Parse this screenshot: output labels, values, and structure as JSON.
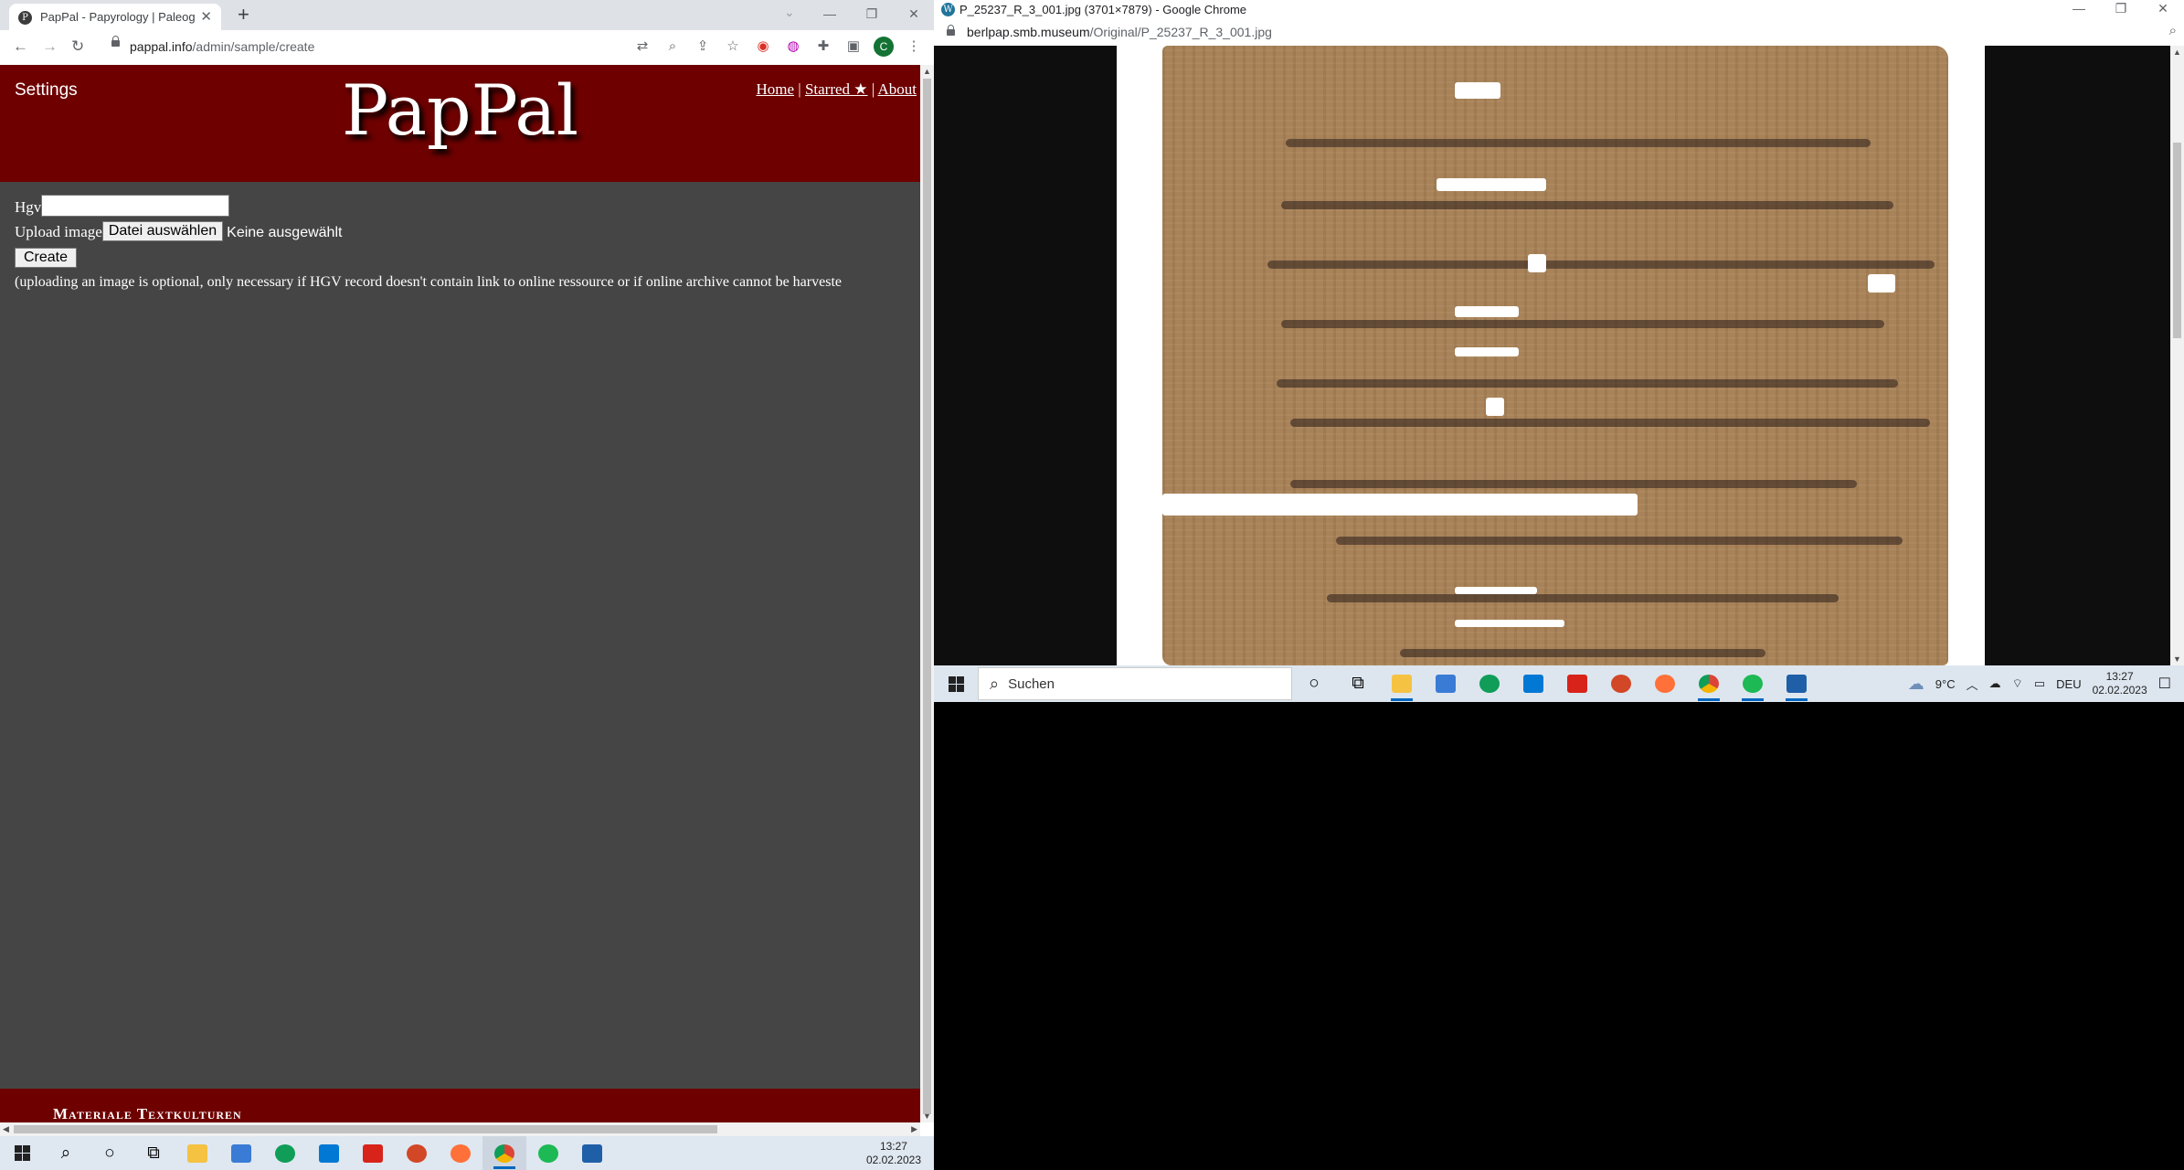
{
  "left_window": {
    "tab_title": "PapPal - Papyrology | Paleograph",
    "new_tab_symbol": "+",
    "url_host": "pappal.info",
    "url_path": "/admin/sample/create",
    "profile_initial": "C",
    "page": {
      "settings_label": "Settings",
      "logo_text": "PapPal",
      "nav": {
        "home": "Home",
        "separator": "|",
        "starred": "Starred ★",
        "about": "About"
      },
      "form": {
        "hgv_label": "Hgv",
        "hgv_value": "",
        "upload_label": "Upload image",
        "file_button": "Datei auswählen",
        "file_status": "Keine ausgewählt",
        "create_button": "Create",
        "note": "(uploading an image is optional, only necessary if HGV record doesn't contain link to online ressource or if online archive cannot be harveste"
      },
      "footer_text": "Materiale Textkulturen"
    }
  },
  "right_window": {
    "title": "P_25237_R_3_001.jpg (3701×7879) - Google Chrome",
    "url_host": "berlpap.smb.museum",
    "url_path": "/Original/P_25237_R_3_001.jpg"
  },
  "taskbar_left": {
    "time": "13:27",
    "date": "02.02.2023"
  },
  "taskbar_right": {
    "search_placeholder": "Suchen",
    "weather": "9°C",
    "language": "DEU",
    "time": "13:27",
    "date": "02.02.2023"
  },
  "colors": {
    "header_bg": "#6e0000",
    "page_bg": "#454545",
    "taskbar_bg": "#dfe7f0"
  },
  "icons": [
    "back-arrow-icon",
    "forward-arrow-icon",
    "reload-icon",
    "lock-icon",
    "translate-icon",
    "zoom-icon",
    "share-icon",
    "star-icon",
    "extension-icon",
    "puzzle-icon",
    "sidepanel-icon",
    "menu-icon",
    "windows-start-icon",
    "search-icon",
    "cortana-icon",
    "task-view-icon",
    "explorer-icon",
    "store-icon",
    "edge-icon",
    "mail-icon",
    "acrobat-icon",
    "powerpoint-icon",
    "firefox-icon",
    "chrome-icon",
    "spotify-icon",
    "photos-icon",
    "cloud-icon",
    "notification-icon"
  ]
}
